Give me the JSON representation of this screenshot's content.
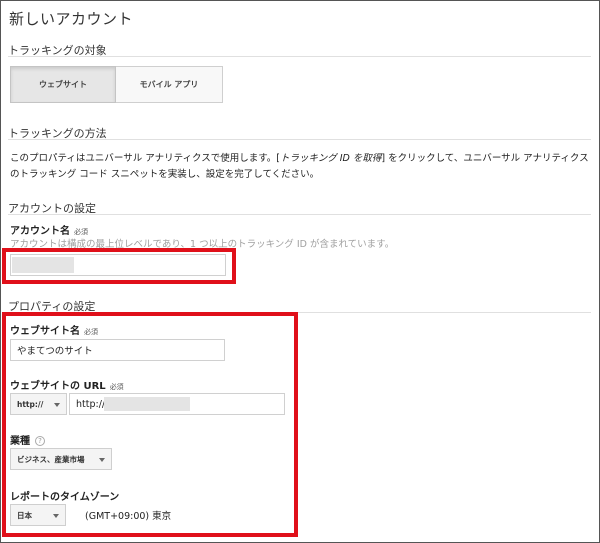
{
  "page": {
    "title": "新しいアカウント"
  },
  "tracking_target": {
    "header": "トラッキングの対象",
    "tabs": [
      {
        "label": "ウェブサイト",
        "selected": true
      },
      {
        "label": "モバイル アプリ",
        "selected": false
      }
    ]
  },
  "tracking_method": {
    "header": "トラッキングの方法",
    "desc_part1": "このプロパティはユニバーサル アナリティクスで使用します。[",
    "desc_em": "トラッキング ID を取得",
    "desc_part2": "] をクリックして、ユニバーサル アナリティクスのトラッキング コード スニペットを実装し、設定を完了してください。"
  },
  "account_settings": {
    "header": "アカウントの設定",
    "name_label": "アカウント名",
    "required": "必須",
    "help": "アカウントは構成の最上位レベルであり、1 つ以上のトラッキング ID が含まれています。",
    "name_value": ""
  },
  "property_settings": {
    "header": "プロパティの設定",
    "website_name_label": "ウェブサイト名",
    "website_name_value": "やまてつのサイト",
    "url_label": "ウェブサイトの URL",
    "url_protocol": "http://",
    "url_value": "http://",
    "industry_label": "業種",
    "industry_help_icon": "?",
    "industry_value": "ビジネス、産業市場",
    "timezone_label": "レポートのタイムゾーン",
    "timezone_country": "日本",
    "timezone_value": "(GMT+09:00) 東京",
    "required": "必須"
  },
  "colors": {
    "highlight": "#e0101a"
  }
}
